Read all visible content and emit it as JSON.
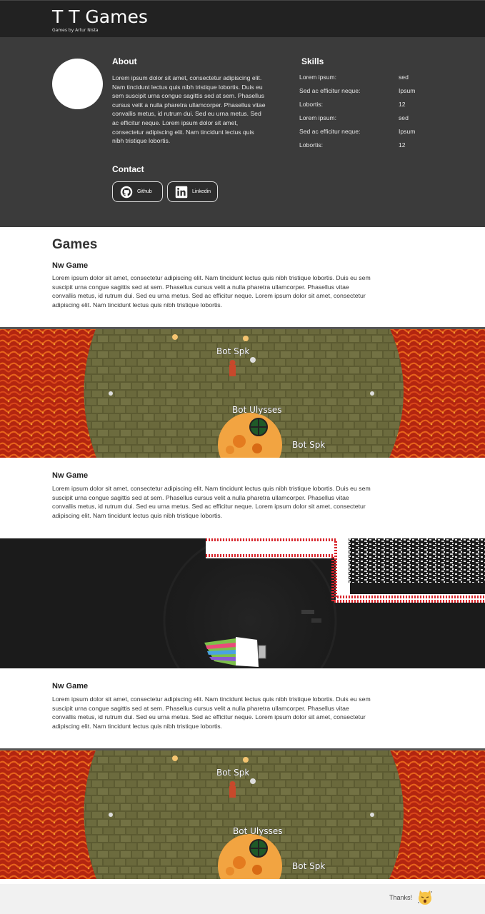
{
  "header": {
    "title": "T T Games",
    "subtitle": "Games by Artur Nista"
  },
  "about": {
    "heading": "About",
    "text": "Lorem ipsum dolor sit amet, consectetur adipiscing elit. Nam tincidunt lectus quis nibh tristique lobortis. Duis eu sem suscipit urna congue sagittis sed at sem. Phasellus cursus velit a nulla pharetra ullamcorper. Phasellus vitae convallis metus, id rutrum dui. Sed eu urna metus. Sed ac efficitur neque. Lorem ipsum dolor sit amet, consectetur adipiscing elit. Nam tincidunt lectus quis nibh tristique lobortis."
  },
  "skills": {
    "heading": "Skills",
    "rows": [
      {
        "key": "Lorem ipsum:",
        "value": "sed"
      },
      {
        "key": "Sed ac efficitur neque:",
        "value": "Ipsum"
      },
      {
        "key": "Lobortis:",
        "value": "12"
      },
      {
        "key": "Lorem ipsum:",
        "value": "sed"
      },
      {
        "key": "Sed ac efficitur neque:",
        "value": "Ipsum"
      },
      {
        "key": "Lobortis:",
        "value": "12"
      }
    ]
  },
  "contact": {
    "heading": "Contact",
    "github_label": "Github",
    "linkedin_label": "Linkedin",
    "github_icon": "github-icon",
    "linkedin_icon": "linkedin-icon"
  },
  "games": {
    "heading": "Games",
    "items": [
      {
        "name": "Nw Game",
        "description": "Lorem ipsum dolor sit amet, consectetur adipiscing elit. Nam tincidunt lectus quis nibh tristique lobortis. Duis eu sem suscipit urna congue sagittis sed at sem. Phasellus cursus velit a nulla pharetra ullamcorper. Phasellus vitae convallis metus, id rutrum dui. Sed eu urna metus. Sed ac efficitur neque. Lorem ipsum dolor sit amet, consectetur adipiscing elit. Nam tincidunt lectus quis nibh tristique lobortis.",
        "labels": [
          "Bot Spk",
          "Bot Ulysses",
          "Bot Spk"
        ]
      },
      {
        "name": "Nw Game",
        "description": "Lorem ipsum dolor sit amet, consectetur adipiscing elit. Nam tincidunt lectus quis nibh tristique lobortis. Duis eu sem suscipit urna congue sagittis sed at sem. Phasellus cursus velit a nulla pharetra ullamcorper. Phasellus vitae convallis metus, id rutrum dui. Sed eu urna metus. Sed ac efficitur neque. Lorem ipsum dolor sit amet, consectetur adipiscing elit. Nam tincidunt lectus quis nibh tristique lobortis."
      },
      {
        "name": "Nw Game",
        "description": "Lorem ipsum dolor sit amet, consectetur adipiscing elit. Nam tincidunt lectus quis nibh tristique lobortis. Duis eu sem suscipit urna congue sagittis sed at sem. Phasellus cursus velit a nulla pharetra ullamcorper. Phasellus vitae convallis metus, id rutrum dui. Sed eu urna metus. Sed ac efficitur neque. Lorem ipsum dolor sit amet, consectetur adipiscing elit. Nam tincidunt lectus quis nibh tristique lobortis.",
        "labels": [
          "Bot Spk",
          "Bot Ulysses",
          "Bot Spk"
        ]
      }
    ]
  },
  "footer": {
    "text": "Thanks!",
    "icon": "cat-emoji-icon"
  },
  "colors": {
    "header_bg": "#222222",
    "profile_bg": "#3b3b3b",
    "footer_bg": "#f1f1f1",
    "lava": "#b52a12",
    "brick": "#6b6a3c"
  }
}
